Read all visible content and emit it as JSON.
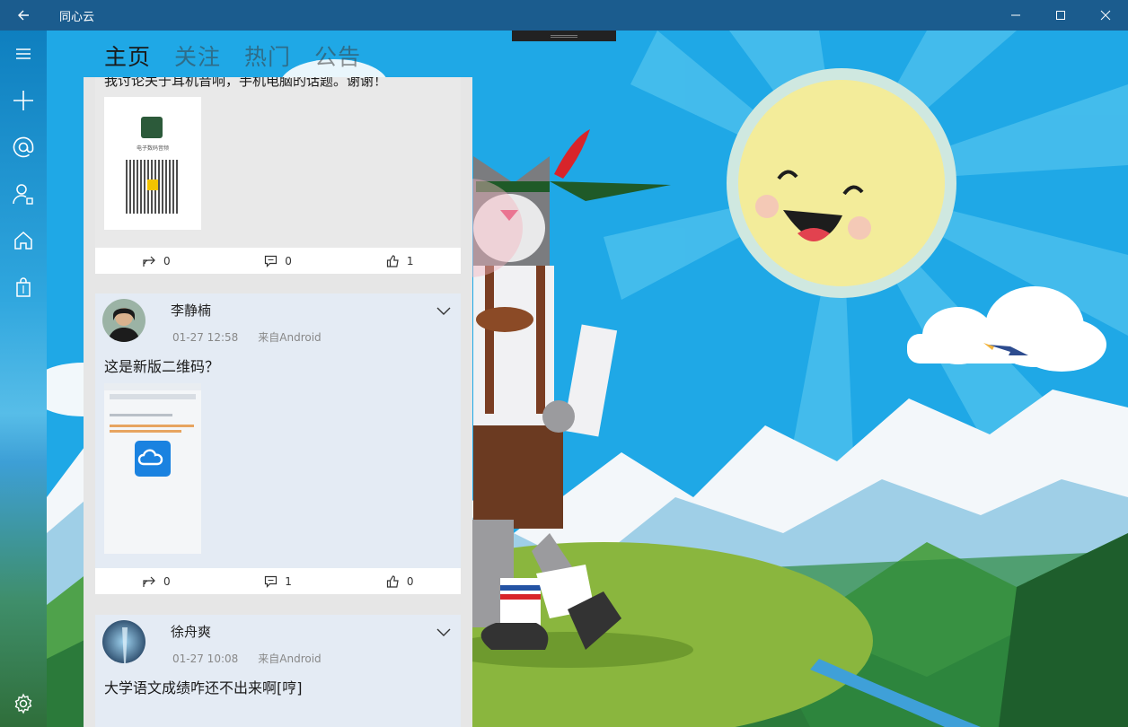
{
  "window": {
    "title": "同心云"
  },
  "tabs": [
    {
      "label": "主页",
      "active": true
    },
    {
      "label": "关注",
      "active": false
    },
    {
      "label": "热门",
      "active": false
    },
    {
      "label": "公告",
      "active": false
    }
  ],
  "rail": {
    "icons": [
      "hamburger-menu-icon",
      "plus-icon",
      "at-mention-icon",
      "contacts-icon",
      "home-icon",
      "bag-icon",
      "settings-gear-icon"
    ]
  },
  "posts": [
    {
      "text": "我讨论关于耳机音响，手机电脑的话题。谢谢！",
      "image_caption": "电子数码音频",
      "repost": "0",
      "comments": "0",
      "likes": "1"
    },
    {
      "author": "李静楠",
      "time": "01-27 12:58",
      "source": "来自Android",
      "text": "这是新版二维码？",
      "repost": "0",
      "comments": "1",
      "likes": "0"
    },
    {
      "author": "徐舟爽",
      "time": "01-27 10:08",
      "source": "来自Android",
      "text": "大学语文成绩咋还不出来啊[哼]"
    }
  ],
  "colors": {
    "titlebar": "#1b5c8e",
    "sky": "#1fa8e6",
    "sun": "#f3ec9a",
    "card": "#e4ebf4"
  }
}
